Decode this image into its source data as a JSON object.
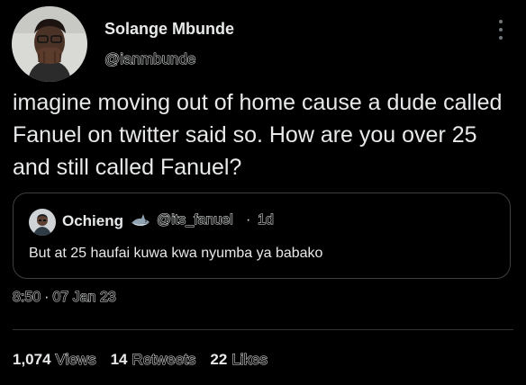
{
  "colors": {
    "background": "#000000",
    "text": "#e7e9ea",
    "border": "#3b3f43",
    "divider": "#2f3336"
  },
  "author": {
    "name": "Solange Mbunde",
    "handle": "@ianmbunde",
    "avatar_icon": "avatar-photo"
  },
  "more_icon": "more-vertical-icon",
  "tweet": {
    "text": "imagine moving out of home cause a dude called Fanuel on twitter said so. How are you over 25 and still called Fanuel?"
  },
  "quoted_tweet": {
    "name": "Ochieng",
    "emoji_icon": "shark-icon",
    "handle": "@its_fanuel",
    "separator": "·",
    "time": "1d",
    "text": "But at 25 haufai kuwa kwa nyumba ya babako"
  },
  "timestamp": {
    "time": "8:50",
    "separator": "·",
    "date": "07 Jan 23"
  },
  "stats": {
    "views_count": "1,074",
    "views_label": "Views",
    "retweets_count": "14",
    "retweets_label": "Retweets",
    "likes_count": "22",
    "likes_label": "Likes"
  }
}
